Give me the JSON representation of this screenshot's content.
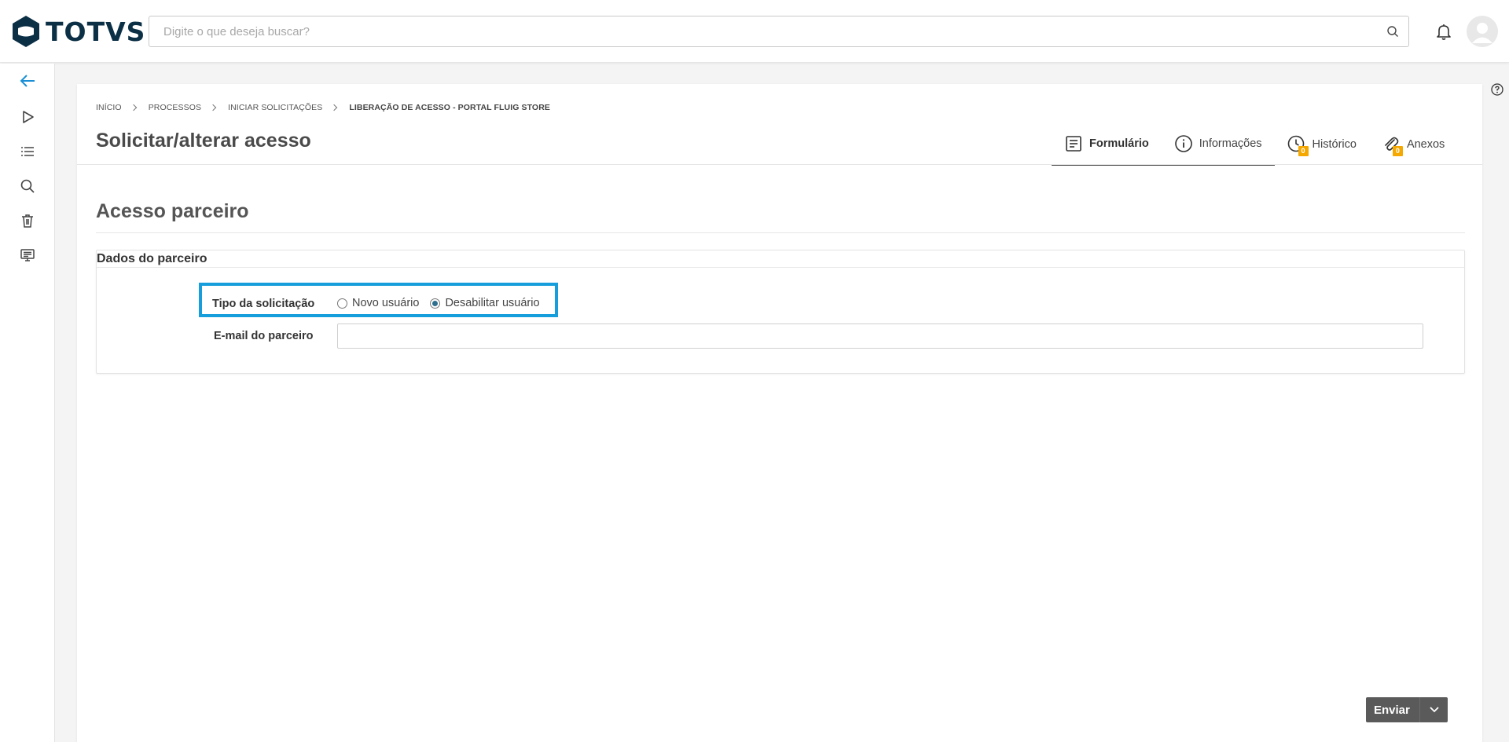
{
  "brand": {
    "name": "TOTVS"
  },
  "header": {
    "search_placeholder": "Digite o que deseja buscar?"
  },
  "breadcrumb": [
    {
      "label": "INÍCIO"
    },
    {
      "label": "PROCESSOS"
    },
    {
      "label": "INICIAR SOLICITAÇÕES"
    },
    {
      "label": "LIBERAÇÃO DE ACESSO - PORTAL FLUIG STORE"
    }
  ],
  "page": {
    "title": "Solicitar/alterar acesso"
  },
  "tabs": {
    "formulario": {
      "label": "Formulário",
      "active": true
    },
    "informacoes": {
      "label": "Informações"
    },
    "historico": {
      "label": "Histórico",
      "badge": "0"
    },
    "anexos": {
      "label": "Anexos",
      "badge": "0"
    }
  },
  "form": {
    "section_title": "Acesso parceiro",
    "fieldset_legend": "Dados do parceiro",
    "tipo_label": "Tipo da solicitação",
    "options": [
      {
        "label": "Novo usuário",
        "checked": false
      },
      {
        "label": "Desabilitar usuário",
        "checked": true
      }
    ],
    "email_label": "E-mail do parceiro",
    "email_value": ""
  },
  "actions": {
    "send_label": "Enviar"
  },
  "colors": {
    "highlight": "#169ddb",
    "brand": "#0b2f45",
    "accent_nav": "#1a8fd6",
    "badge": "#f5a800"
  }
}
